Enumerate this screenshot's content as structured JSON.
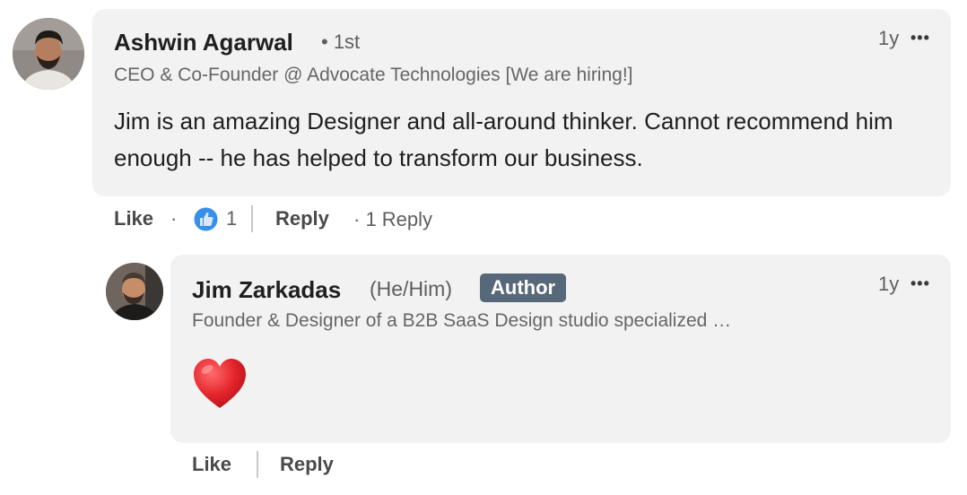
{
  "comment": {
    "author_name": "Ashwin Agarwal",
    "degree": "• 1st",
    "headline": "CEO & Co-Founder @ Advocate Technologies [We are hiring!]",
    "text": "Jim is an amazing Designer and all-around thinker. Cannot recommend him enough -- he has helped to transform our business.",
    "time": "1y",
    "more_label": "•••",
    "actions": {
      "like_label": "Like",
      "dot": "·",
      "reaction_count": "1",
      "reply_label": "Reply",
      "reply_count_label": "· 1 Reply"
    }
  },
  "reply": {
    "author_name": "Jim Zarkadas",
    "pronouns": "(He/Him)",
    "badge": "Author",
    "headline": "Founder & Designer of a B2B SaaS Design studio specialized …",
    "text": "❤️",
    "time": "1y",
    "more_label": "•••",
    "actions": {
      "like_label": "Like",
      "reply_label": "Reply"
    }
  },
  "colors": {
    "bubble_bg": "#f2f2f2",
    "badge_bg": "#56687a",
    "like_blue": "#378fe9"
  },
  "icons": {
    "reaction": "like-thumbs-up-icon",
    "more": "ellipsis-icon"
  }
}
